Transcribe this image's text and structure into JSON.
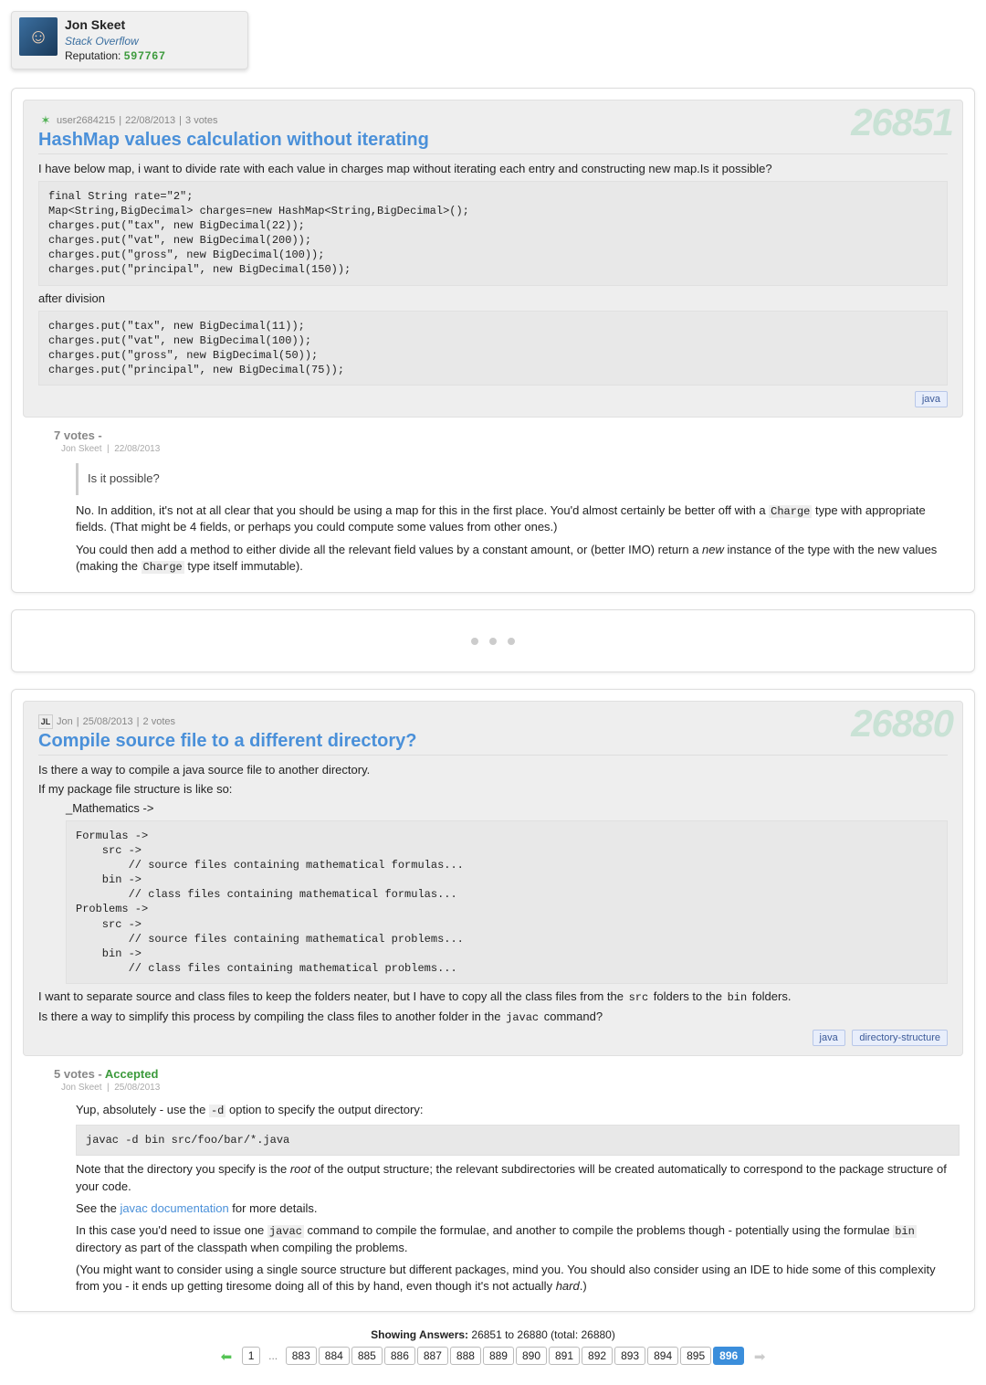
{
  "user": {
    "name": "Jon Skeet",
    "site": "Stack Overflow",
    "rep_label": "Reputation:",
    "rep_value": "597767"
  },
  "questions": [
    {
      "number": "26851",
      "asker_icon_color": "#4caf50",
      "asker": "user2684215",
      "date": "22/08/2013",
      "votes_text": "3 votes",
      "title": "HashMap values calculation without iterating",
      "intro": "I have below map, i want to divide rate with each value in charges map without iterating each entry and constructing new map.Is it possible?",
      "code1": "final String rate=\"2\";\nMap<String,BigDecimal> charges=new HashMap<String,BigDecimal>();\ncharges.put(\"tax\", new BigDecimal(22));\ncharges.put(\"vat\", new BigDecimal(200));\ncharges.put(\"gross\", new BigDecimal(100));\ncharges.put(\"principal\", new BigDecimal(150));",
      "after_text": "after division",
      "code2": "charges.put(\"tax\", new BigDecimal(11));\ncharges.put(\"vat\", new BigDecimal(100));\ncharges.put(\"gross\", new BigDecimal(50));\ncharges.put(\"principal\", new BigDecimal(75));",
      "tags": [
        "java"
      ],
      "answer": {
        "votes": "7 votes -",
        "accepted": "",
        "by": "Jon Skeet",
        "by_date": "22/08/2013",
        "quote": "Is it possible?",
        "p1_pre": "No. In addition, it's not at all clear that you should be using a map for this in the first place. You'd almost certainly be better off with a ",
        "p1_code": "Charge",
        "p1_post": " type with appropriate fields. (That might be 4 fields, or perhaps you could compute some values from other ones.)",
        "p2_pre": "You could then add a method to either divide all the relevant field values by a constant amount, or (better IMO) return a ",
        "p2_em": "new",
        "p2_mid": " instance of the type with the new values (making the ",
        "p2_code": "Charge",
        "p2_post": " type itself immutable)."
      }
    },
    {
      "number": "26880",
      "asker_icon_color": "#333",
      "asker": "Jon",
      "date": "25/08/2013",
      "votes_text": "2 votes",
      "title": "Compile source file to a different directory?",
      "p1": "Is there a way to compile a java source file to another directory.",
      "p2": "If my package file structure is like so:",
      "tree_label": "_Mathematics ->",
      "code1": "Formulas ->\n    src ->\n        // source files containing mathematical formulas...\n    bin ->\n        // class files containing mathematical formulas...\nProblems ->\n    src ->\n        // source files containing mathematical problems...\n    bin ->\n        // class files containing mathematical problems...",
      "p3_pre": "I want to separate source and class files to keep the folders neater, but I have to copy all the class files from the ",
      "p3_c1": "src",
      "p3_mid": " folders to the ",
      "p3_c2": "bin",
      "p3_post": " folders.",
      "p4_pre": "Is there a way to simplify this process by compiling the class files to another folder in the ",
      "p4_c": "javac",
      "p4_post": " command?",
      "tags": [
        "java",
        "directory-structure"
      ],
      "answer": {
        "votes": "5 votes -",
        "accepted": "Accepted",
        "by": "Jon Skeet",
        "by_date": "25/08/2013",
        "p1_pre": "Yup, absolutely - use the ",
        "p1_code": "-d",
        "p1_post": " option to specify the output directory:",
        "code": "javac -d bin src/foo/bar/*.java",
        "p2_pre": "Note that the directory you specify is the ",
        "p2_em": "root",
        "p2_post": " of the output structure; the relevant subdirectories will be created automatically to correspond to the package structure of your code.",
        "p3_pre": "See the ",
        "p3_link": "javac documentation",
        "p3_post": " for more details.",
        "p4_pre": "In this case you'd need to issue one ",
        "p4_c1": "javac",
        "p4_mid": " command to compile the formulae, and another to compile the problems though - potentially using the formulae ",
        "p4_c2": "bin",
        "p4_post": " directory as part of the classpath when compiling the problems.",
        "p5_pre": "(You might want to consider using a single source structure but different packages, mind you. You should also consider using an IDE to hide some of this complexity from you - it ends up getting tiresome doing all of this by hand, even though it's not actually ",
        "p5_em": "hard",
        "p5_post": ".)"
      }
    }
  ],
  "footer": {
    "label": "Showing Answers:",
    "range": "26851 to 26880 (total: 26880)"
  },
  "pagination": {
    "first": "1",
    "ellipsis": "...",
    "pages": [
      "883",
      "884",
      "885",
      "886",
      "887",
      "888",
      "889",
      "890",
      "891",
      "892",
      "893",
      "894",
      "895",
      "896"
    ],
    "current": "896"
  }
}
